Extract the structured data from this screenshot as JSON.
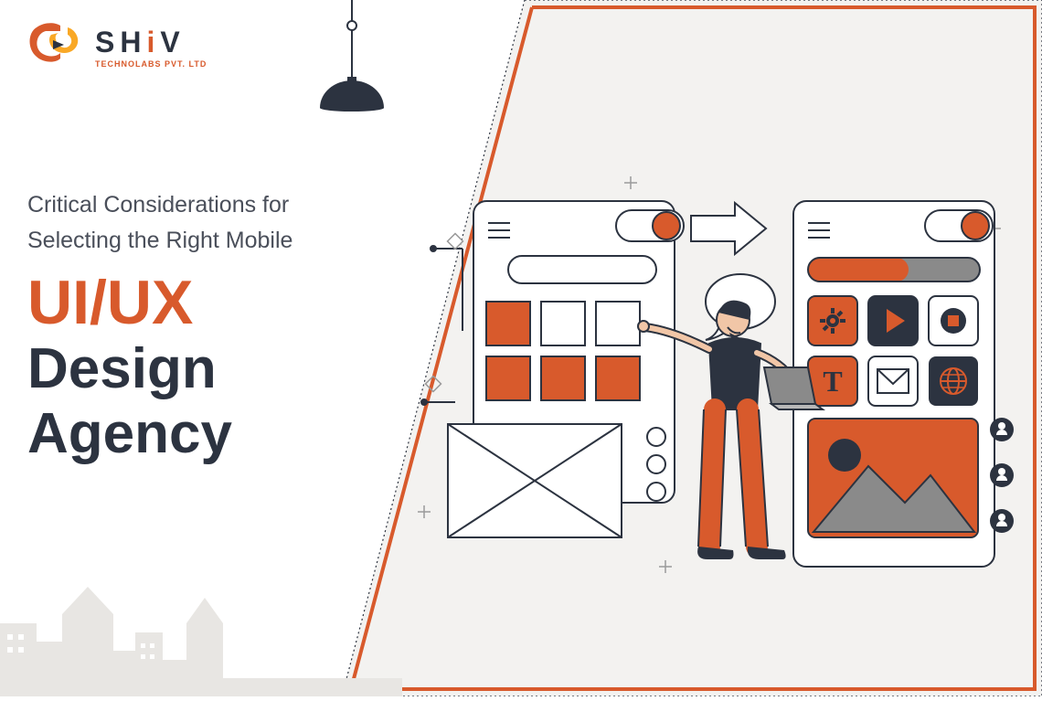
{
  "brand": {
    "name": "SHiV",
    "tagline": "TECHNOLABS PVT. LTD"
  },
  "headline": {
    "line1": "Critical Considerations for",
    "line2": "Selecting the Right Mobile",
    "accent": "UI/UX",
    "rest1": "Design",
    "rest2": "Agency"
  },
  "colors": {
    "accent": "#d85a2c",
    "dark": "#2c3340",
    "panel": "#f3f2f0",
    "skyline": "#e8e6e3",
    "midgrey": "#8a8a8a"
  },
  "icons": {
    "lamp": "pendant-lamp-icon",
    "gear": "gear-icon",
    "play": "play-icon",
    "stop": "stop-icon",
    "type": "type-icon",
    "mail": "mail-icon",
    "globe": "globe-icon",
    "person": "person-icon"
  }
}
